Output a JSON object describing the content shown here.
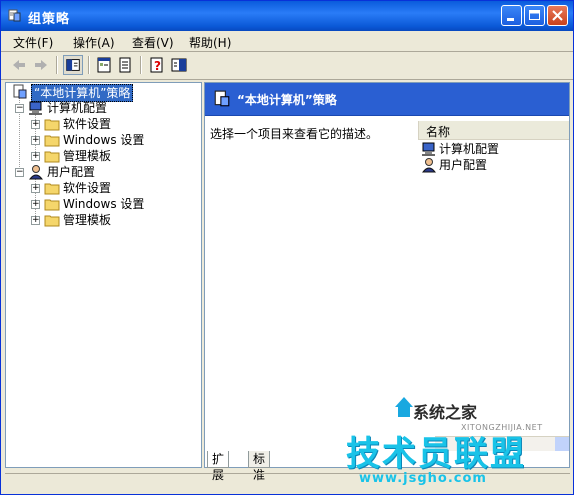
{
  "window": {
    "title": "组策略"
  },
  "menu": {
    "file": "文件(F)",
    "action": "操作(A)",
    "view": "查看(V)",
    "help": "帮助(H)"
  },
  "tree": {
    "root": "“本地计算机”策略",
    "computer": "计算机配置",
    "user": "用户配置",
    "software": "软件设置",
    "windows": "Windows 设置",
    "admin": "管理模板"
  },
  "right": {
    "header": "“本地计算机”策略",
    "description": "选择一个项目来查看它的描述。",
    "column_name": "名称",
    "items": [
      "计算机配置",
      "用户配置"
    ]
  },
  "tabs": {
    "expand": "扩展",
    "standard": "标准"
  },
  "watermark": {
    "site_cn": "系统之家",
    "site_en": "XITONGZHIJIA.NET",
    "slogan": "技术员联盟",
    "url": "www.jsgho.com"
  },
  "colors": {
    "title_bar": "#0a58d6",
    "header_blue": "#2a5fd2",
    "selection": "#316ac5",
    "watermark": "#19c3e8"
  }
}
